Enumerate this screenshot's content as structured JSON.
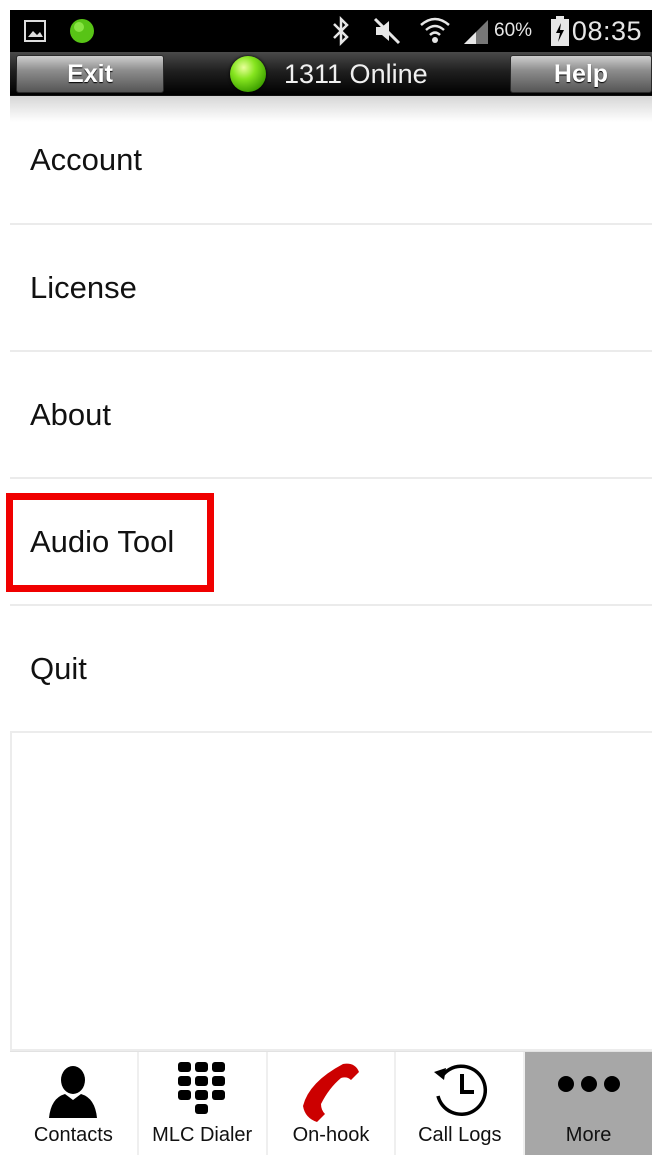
{
  "status_bar": {
    "battery_pct": "60%",
    "time": "08:35"
  },
  "header": {
    "exit_label": "Exit",
    "status_text": "1311 Online",
    "help_label": "Help"
  },
  "menu": {
    "items": [
      {
        "label": "Account"
      },
      {
        "label": "License"
      },
      {
        "label": "About"
      },
      {
        "label": "Audio Tool"
      },
      {
        "label": "Quit"
      }
    ]
  },
  "tabs": [
    {
      "label": "Contacts",
      "icon": "contacts-icon"
    },
    {
      "label": "MLC Dialer",
      "icon": "dialpad-icon"
    },
    {
      "label": "On-hook",
      "icon": "phone-handset-icon"
    },
    {
      "label": "Call Logs",
      "icon": "call-history-icon"
    },
    {
      "label": "More",
      "icon": "more-dots-icon",
      "selected": true
    }
  ],
  "colors": {
    "highlight": "#f00000",
    "online_dot": "#6ad11a",
    "on_hook": "#cc0000",
    "selected_tab": "#a7a7a7"
  }
}
